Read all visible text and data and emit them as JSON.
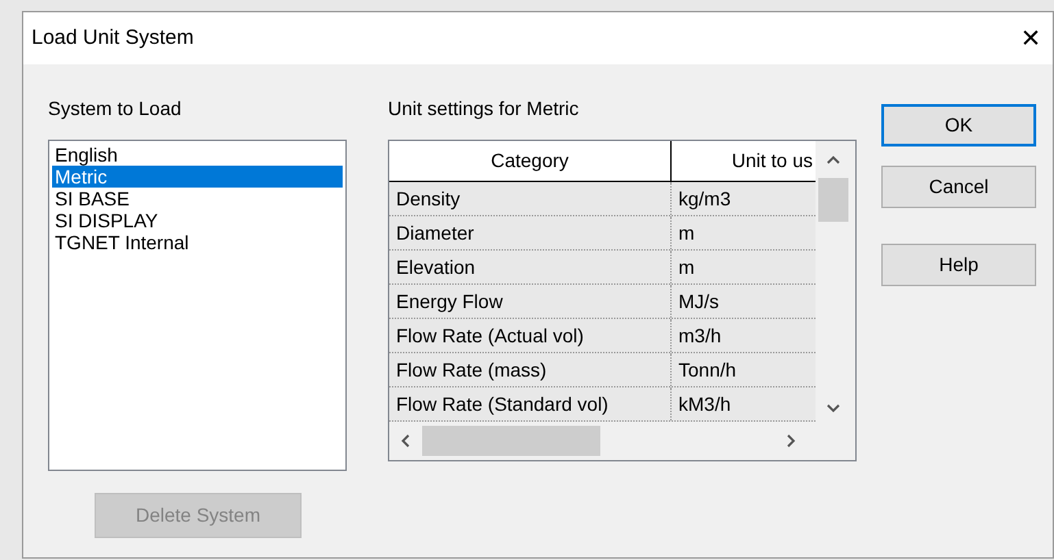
{
  "window": {
    "title": "Load Unit System",
    "close": "✕"
  },
  "systems": {
    "label": "System to Load",
    "items": [
      {
        "label": "English",
        "selected": false
      },
      {
        "label": "Metric",
        "selected": true
      },
      {
        "label": "SI BASE",
        "selected": false
      },
      {
        "label": "SI DISPLAY",
        "selected": false
      },
      {
        "label": "TGNET Internal",
        "selected": false
      }
    ]
  },
  "delete_button": {
    "label": "Delete System",
    "disabled": true
  },
  "settings": {
    "label": "Unit settings for Metric",
    "columns": [
      "Category",
      "Unit to us"
    ],
    "rows": [
      [
        "Density",
        "kg/m3"
      ],
      [
        "Diameter",
        "m"
      ],
      [
        "Elevation",
        "m"
      ],
      [
        "Energy Flow",
        "MJ/s"
      ],
      [
        "Flow Rate (Actual vol)",
        "m3/h"
      ],
      [
        "Flow Rate (mass)",
        "Tonn/h"
      ],
      [
        "Flow Rate (Standard vol)",
        "kM3/h"
      ]
    ]
  },
  "buttons": [
    {
      "label": "OK",
      "default": true
    },
    {
      "label": "Cancel",
      "default": false
    },
    {
      "label": "Help",
      "default": false
    }
  ]
}
